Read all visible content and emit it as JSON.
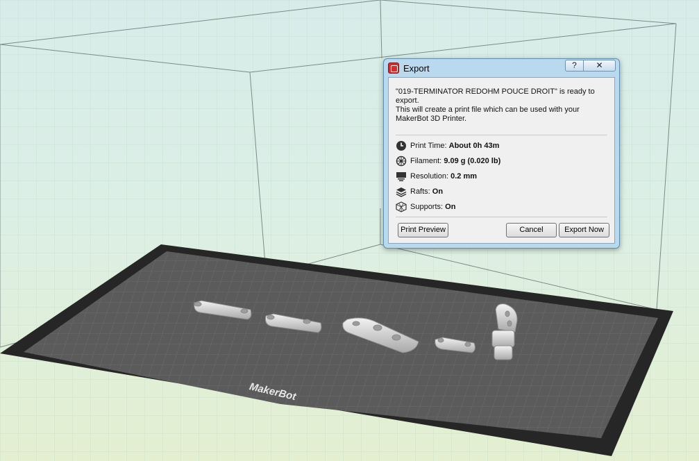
{
  "dialog": {
    "title": "Export",
    "help_label": "?",
    "close_label": "✕",
    "message_line1": "\"019-TERMINATOR REDOHM POUCE DROIT\" is ready to export.",
    "message_line2": "This will create a print file which can be used with your",
    "message_line3": "MakerBot 3D Printer.",
    "info": {
      "print_time_label": "Print Time:",
      "print_time_value": "About 0h 43m",
      "filament_label": "Filament:",
      "filament_value": "9.09 g (0.020 lb)",
      "resolution_label": "Resolution:",
      "resolution_value": "0.2 mm",
      "rafts_label": "Rafts:",
      "rafts_value": "On",
      "supports_label": "Supports:",
      "supports_value": "On"
    },
    "buttons": {
      "print_preview": "Print Preview",
      "cancel": "Cancel",
      "export_now": "Export Now"
    }
  },
  "build_plate": {
    "logo_text": "MakerBot"
  },
  "colors": {
    "plate_fill": "#5b5b5b",
    "plate_border": "#262626",
    "dialog_frame": "#b9d9ef"
  },
  "icons": [
    "clock-icon",
    "filament-icon",
    "resolution-icon",
    "rafts-icon",
    "supports-icon",
    "makerbot-app-icon"
  ]
}
